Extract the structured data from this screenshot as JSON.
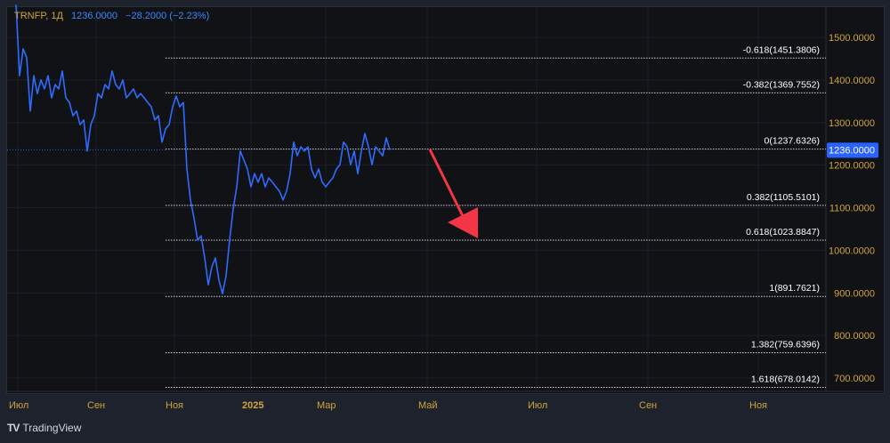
{
  "legend": {
    "symbol": "TRNFP, 1Д",
    "price": "1236.0000",
    "change": "−28.2000 (−2.23%)"
  },
  "colors": {
    "line": "#2f6bff",
    "fib": "#d1d4dc",
    "arrow": "#f23645",
    "axis_text": "#d1a43a",
    "badge": "#2962ff"
  },
  "chart_data": {
    "type": "line",
    "title": "TRNFP, 1Д",
    "ylim": [
      660,
      1580
    ],
    "y_ticks": [
      "1500.0000",
      "1400.0000",
      "1300.0000",
      "1200.0000",
      "1100.0000",
      "1000.0000",
      "900.0000",
      "800.0000",
      "700.0000"
    ],
    "y_tick_values": [
      1500,
      1400,
      1300,
      1200,
      1100,
      1000,
      900,
      800,
      700
    ],
    "x_ticks": [
      "Июл",
      "Сен",
      "Ноя",
      "2025",
      "Мар",
      "Май",
      "Июл",
      "Сен",
      "Ноя"
    ],
    "current_price": {
      "value": 1236,
      "label": "1236.0000"
    },
    "series": [
      {
        "name": "TRNFP close",
        "values": [
          1577,
          1410,
          1473,
          1452,
          1327,
          1410,
          1368,
          1400,
          1379,
          1410,
          1358,
          1389,
          1379,
          1421,
          1358,
          1347,
          1316,
          1327,
          1295,
          1306,
          1233,
          1295,
          1316,
          1368,
          1358,
          1389,
          1379,
          1421,
          1389,
          1379,
          1400,
          1358,
          1368,
          1379,
          1358,
          1368,
          1358,
          1347,
          1337,
          1306,
          1316,
          1254,
          1285,
          1295,
          1337,
          1362,
          1337,
          1347,
          1191,
          1118,
          1076,
          1024,
          1034,
          982,
          919,
          961,
          982,
          930,
          898,
          940,
          1024,
          1097,
          1149,
          1233,
          1212,
          1191,
          1149,
          1180,
          1160,
          1180,
          1149,
          1170,
          1160,
          1149,
          1139,
          1118,
          1139,
          1180,
          1254,
          1222,
          1243,
          1233,
          1243,
          1191,
          1170,
          1191,
          1160,
          1149,
          1160,
          1170,
          1191,
          1201,
          1254,
          1243,
          1201,
          1233,
          1180,
          1233,
          1274,
          1243,
          1201,
          1243,
          1233,
          1222,
          1264,
          1236
        ]
      }
    ],
    "fib_levels": [
      {
        "label": "-0.618(1451.3806)",
        "value": 1451.3806
      },
      {
        "label": "-0.382(1369.7552)",
        "value": 1369.7552
      },
      {
        "label": "0(1237.6326)",
        "value": 1237.6326
      },
      {
        "label": "0.382(1105.5101)",
        "value": 1105.5101
      },
      {
        "label": "0.618(1023.8847)",
        "value": 1023.8847
      },
      {
        "label": "1(891.7621)",
        "value": 891.7621
      },
      {
        "label": "1.382(759.6396)",
        "value": 759.6396
      },
      {
        "label": "1.618(678.0142)",
        "value": 678.0142
      }
    ],
    "annotation": "down-arrow"
  },
  "brand": "TradingView"
}
